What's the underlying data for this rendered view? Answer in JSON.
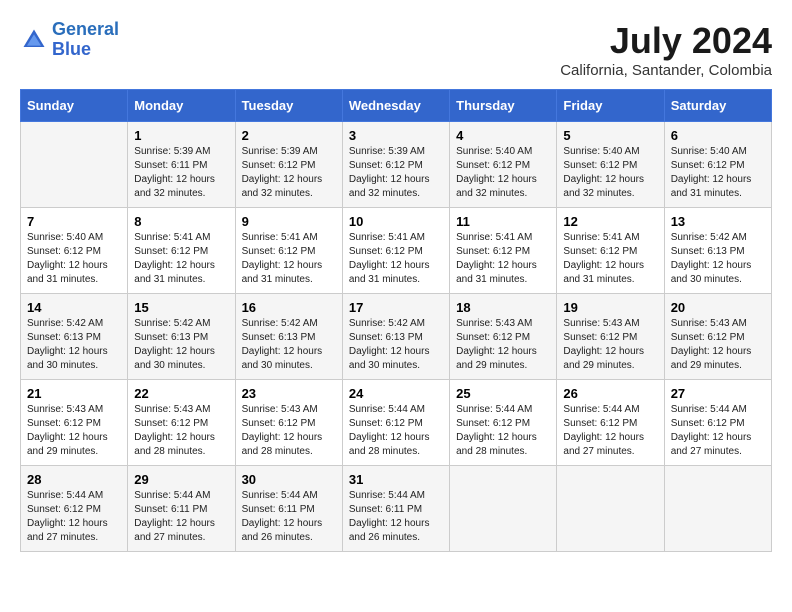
{
  "header": {
    "logo_line1": "General",
    "logo_line2": "Blue",
    "month_year": "July 2024",
    "location": "California, Santander, Colombia"
  },
  "days_of_week": [
    "Sunday",
    "Monday",
    "Tuesday",
    "Wednesday",
    "Thursday",
    "Friday",
    "Saturday"
  ],
  "weeks": [
    [
      {
        "num": "",
        "info": ""
      },
      {
        "num": "1",
        "info": "Sunrise: 5:39 AM\nSunset: 6:11 PM\nDaylight: 12 hours\nand 32 minutes."
      },
      {
        "num": "2",
        "info": "Sunrise: 5:39 AM\nSunset: 6:12 PM\nDaylight: 12 hours\nand 32 minutes."
      },
      {
        "num": "3",
        "info": "Sunrise: 5:39 AM\nSunset: 6:12 PM\nDaylight: 12 hours\nand 32 minutes."
      },
      {
        "num": "4",
        "info": "Sunrise: 5:40 AM\nSunset: 6:12 PM\nDaylight: 12 hours\nand 32 minutes."
      },
      {
        "num": "5",
        "info": "Sunrise: 5:40 AM\nSunset: 6:12 PM\nDaylight: 12 hours\nand 32 minutes."
      },
      {
        "num": "6",
        "info": "Sunrise: 5:40 AM\nSunset: 6:12 PM\nDaylight: 12 hours\nand 31 minutes."
      }
    ],
    [
      {
        "num": "7",
        "info": "Sunrise: 5:40 AM\nSunset: 6:12 PM\nDaylight: 12 hours\nand 31 minutes."
      },
      {
        "num": "8",
        "info": "Sunrise: 5:41 AM\nSunset: 6:12 PM\nDaylight: 12 hours\nand 31 minutes."
      },
      {
        "num": "9",
        "info": "Sunrise: 5:41 AM\nSunset: 6:12 PM\nDaylight: 12 hours\nand 31 minutes."
      },
      {
        "num": "10",
        "info": "Sunrise: 5:41 AM\nSunset: 6:12 PM\nDaylight: 12 hours\nand 31 minutes."
      },
      {
        "num": "11",
        "info": "Sunrise: 5:41 AM\nSunset: 6:12 PM\nDaylight: 12 hours\nand 31 minutes."
      },
      {
        "num": "12",
        "info": "Sunrise: 5:41 AM\nSunset: 6:12 PM\nDaylight: 12 hours\nand 31 minutes."
      },
      {
        "num": "13",
        "info": "Sunrise: 5:42 AM\nSunset: 6:13 PM\nDaylight: 12 hours\nand 30 minutes."
      }
    ],
    [
      {
        "num": "14",
        "info": "Sunrise: 5:42 AM\nSunset: 6:13 PM\nDaylight: 12 hours\nand 30 minutes."
      },
      {
        "num": "15",
        "info": "Sunrise: 5:42 AM\nSunset: 6:13 PM\nDaylight: 12 hours\nand 30 minutes."
      },
      {
        "num": "16",
        "info": "Sunrise: 5:42 AM\nSunset: 6:13 PM\nDaylight: 12 hours\nand 30 minutes."
      },
      {
        "num": "17",
        "info": "Sunrise: 5:42 AM\nSunset: 6:13 PM\nDaylight: 12 hours\nand 30 minutes."
      },
      {
        "num": "18",
        "info": "Sunrise: 5:43 AM\nSunset: 6:12 PM\nDaylight: 12 hours\nand 29 minutes."
      },
      {
        "num": "19",
        "info": "Sunrise: 5:43 AM\nSunset: 6:12 PM\nDaylight: 12 hours\nand 29 minutes."
      },
      {
        "num": "20",
        "info": "Sunrise: 5:43 AM\nSunset: 6:12 PM\nDaylight: 12 hours\nand 29 minutes."
      }
    ],
    [
      {
        "num": "21",
        "info": "Sunrise: 5:43 AM\nSunset: 6:12 PM\nDaylight: 12 hours\nand 29 minutes."
      },
      {
        "num": "22",
        "info": "Sunrise: 5:43 AM\nSunset: 6:12 PM\nDaylight: 12 hours\nand 28 minutes."
      },
      {
        "num": "23",
        "info": "Sunrise: 5:43 AM\nSunset: 6:12 PM\nDaylight: 12 hours\nand 28 minutes."
      },
      {
        "num": "24",
        "info": "Sunrise: 5:44 AM\nSunset: 6:12 PM\nDaylight: 12 hours\nand 28 minutes."
      },
      {
        "num": "25",
        "info": "Sunrise: 5:44 AM\nSunset: 6:12 PM\nDaylight: 12 hours\nand 28 minutes."
      },
      {
        "num": "26",
        "info": "Sunrise: 5:44 AM\nSunset: 6:12 PM\nDaylight: 12 hours\nand 27 minutes."
      },
      {
        "num": "27",
        "info": "Sunrise: 5:44 AM\nSunset: 6:12 PM\nDaylight: 12 hours\nand 27 minutes."
      }
    ],
    [
      {
        "num": "28",
        "info": "Sunrise: 5:44 AM\nSunset: 6:12 PM\nDaylight: 12 hours\nand 27 minutes."
      },
      {
        "num": "29",
        "info": "Sunrise: 5:44 AM\nSunset: 6:11 PM\nDaylight: 12 hours\nand 27 minutes."
      },
      {
        "num": "30",
        "info": "Sunrise: 5:44 AM\nSunset: 6:11 PM\nDaylight: 12 hours\nand 26 minutes."
      },
      {
        "num": "31",
        "info": "Sunrise: 5:44 AM\nSunset: 6:11 PM\nDaylight: 12 hours\nand 26 minutes."
      },
      {
        "num": "",
        "info": ""
      },
      {
        "num": "",
        "info": ""
      },
      {
        "num": "",
        "info": ""
      }
    ]
  ]
}
